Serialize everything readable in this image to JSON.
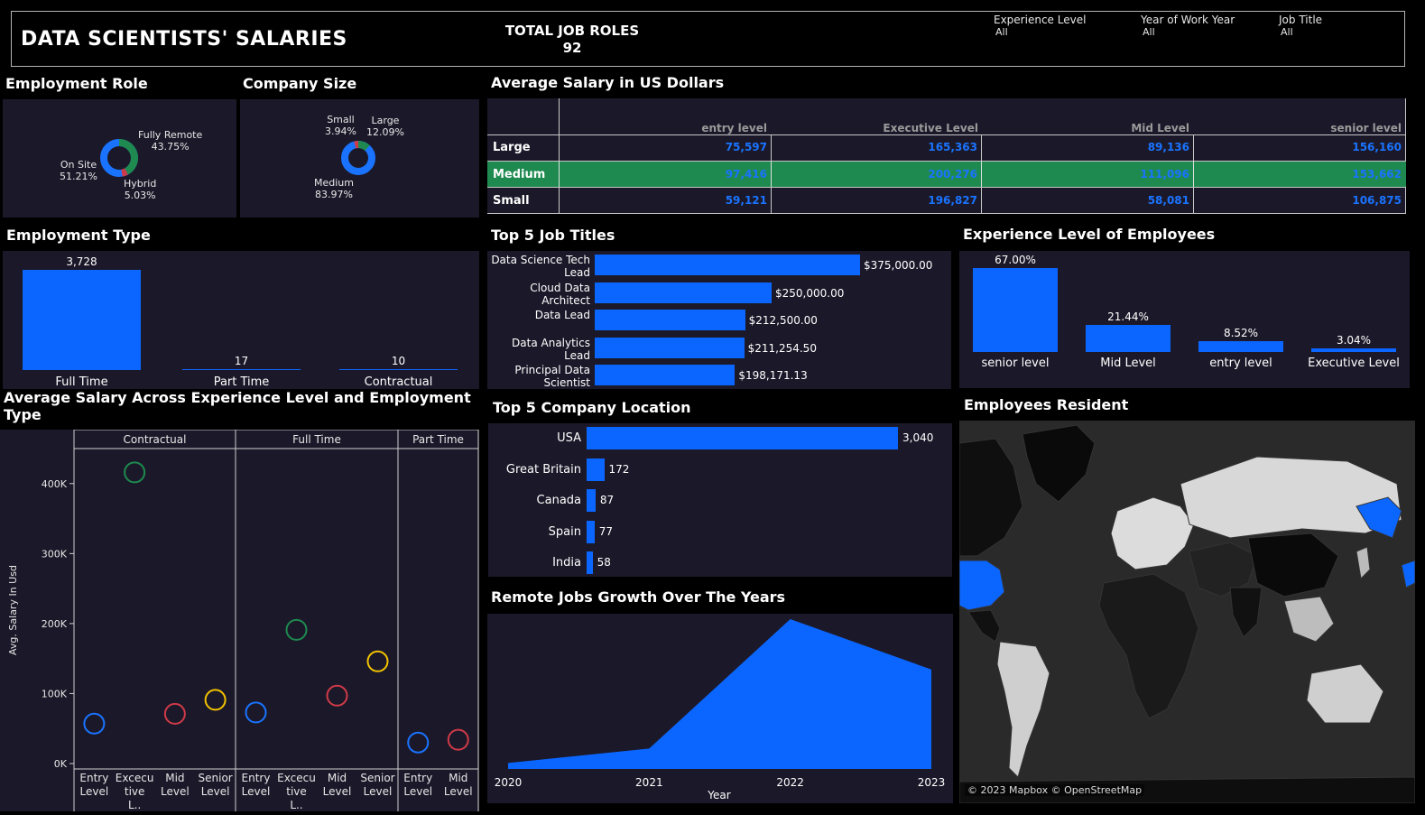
{
  "header": {
    "title": "DATA SCIENTISTS' SALARIES",
    "kpi_label": "TOTAL JOB ROLES",
    "kpi_value": "92",
    "filters": [
      {
        "label": "Experience Level",
        "value": "All"
      },
      {
        "label": "Year of Work Year",
        "value": "All"
      },
      {
        "label": "Job Title",
        "value": "All"
      }
    ]
  },
  "employment_role": {
    "title": "Employment Role",
    "slices": [
      {
        "label": "Fully Remote",
        "value": "43.75%"
      },
      {
        "label": "On Site",
        "value": "51.21%"
      },
      {
        "label": "Hybrid",
        "value": "5.03%"
      }
    ]
  },
  "company_size": {
    "title": "Company Size",
    "slices": [
      {
        "label": "Small",
        "value": "3.94%"
      },
      {
        "label": "Large",
        "value": "12.09%"
      },
      {
        "label": "Medium",
        "value": "83.97%"
      }
    ]
  },
  "avg_salary_table": {
    "title": "Average Salary in US Dollars",
    "columns": [
      "entry level",
      "Executive Level",
      "Mid Level",
      "senior level"
    ],
    "rows": [
      {
        "label": "Large",
        "values": [
          "75,597",
          "165,363",
          "89,136",
          "156,160"
        ]
      },
      {
        "label": "Medium",
        "values": [
          "97,416",
          "200,276",
          "111,096",
          "153,662"
        ]
      },
      {
        "label": "Small",
        "values": [
          "59,121",
          "196,827",
          "58,081",
          "106,875"
        ]
      }
    ]
  },
  "employment_type": {
    "title": "Employment Type"
  },
  "top_jobs": {
    "title": "Top 5 Job Titles"
  },
  "experience_employees": {
    "title": "Experience Level of Employees"
  },
  "avg_salary_scatter": {
    "title": "Average Salary Across Experience Level and Employment Type"
  },
  "top_locations": {
    "title": "Top 5 Company Location"
  },
  "remote_growth": {
    "title": "Remote Jobs Growth Over The Years"
  },
  "map": {
    "title": "Employees Resident",
    "attribution": "© 2023 Mapbox © OpenStreetMap"
  },
  "colors": {
    "accent_blue": "#0b66ff",
    "green": "#1e8a50",
    "red": "#d03a48",
    "yellow": "#f2c200",
    "panel": "#1b1929"
  },
  "chart_data": [
    {
      "type": "bar",
      "id": "employment_type",
      "categories": [
        "Full Time",
        "Part Time",
        "Contractual"
      ],
      "values": [
        3728,
        17,
        10
      ],
      "labels": [
        "3,728",
        "17",
        "10"
      ]
    },
    {
      "type": "bar",
      "id": "top_jobs",
      "orientation": "horizontal",
      "categories": [
        "Data Science Tech Lead",
        "Cloud Data Architect",
        "Data Lead",
        "Data Analytics Lead",
        "Principal Data Scientist"
      ],
      "values": [
        375000,
        250000,
        212500,
        211254.5,
        198171.13
      ],
      "labels": [
        "$375,000.00",
        "$250,000.00",
        "$212,500.00",
        "$211,254.50",
        "$198,171.13"
      ]
    },
    {
      "type": "bar",
      "id": "experience_employees",
      "categories": [
        "senior level",
        "Mid Level",
        "entry level",
        "Executive Level"
      ],
      "values": [
        67.0,
        21.44,
        8.52,
        3.04
      ],
      "labels": [
        "67.00%",
        "21.44%",
        "8.52%",
        "3.04%"
      ]
    },
    {
      "type": "bar",
      "id": "top_locations",
      "orientation": "horizontal",
      "categories": [
        "USA",
        "Great Britain",
        "Canada",
        "Spain",
        "India"
      ],
      "values": [
        3040,
        172,
        87,
        77,
        58
      ],
      "labels": [
        "3,040",
        "172",
        "87",
        "77",
        "58"
      ]
    },
    {
      "type": "area",
      "id": "remote_growth",
      "x": [
        "2020",
        "2021",
        "2022",
        "2023"
      ],
      "y": [
        5,
        17,
        125,
        83
      ],
      "xlabel": "Year"
    },
    {
      "type": "scatter",
      "id": "avg_salary_scatter",
      "ylabel": "Avg. Salary In Usd",
      "yticks": [
        "0K",
        "100K",
        "200K",
        "300K",
        "400K"
      ],
      "ylim": [
        0,
        450000
      ],
      "panels": [
        {
          "name": "Contractual",
          "categories": [
            "Entry Level",
            "Excecu tive L..",
            "Mid Level",
            "Senior Level"
          ],
          "values": [
            57000,
            416000,
            71000,
            91000
          ]
        },
        {
          "name": "Full Time",
          "categories": [
            "Entry Level",
            "Excecu tive L..",
            "Mid Level",
            "Senior Level"
          ],
          "values": [
            73000,
            191000,
            97000,
            146000
          ]
        },
        {
          "name": "Part Time",
          "categories": [
            "Entry Level",
            "Mid Level"
          ],
          "values": [
            30000,
            34000
          ]
        }
      ],
      "point_colors": {
        "Entry Level": "#1a73ff",
        "Excecu tive L..": "#1e8a50",
        "Mid Level": "#d03a48",
        "Senior Level": "#f2c200"
      }
    }
  ]
}
